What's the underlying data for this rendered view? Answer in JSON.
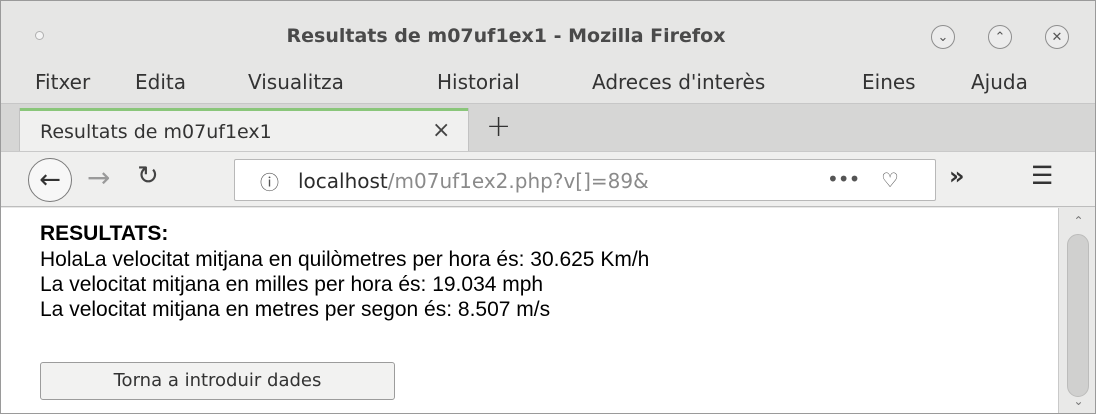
{
  "window": {
    "title": "Resultats de m07uf1ex1 - Mozilla Firefox",
    "controls": [
      "minimize-icon",
      "maximize-icon",
      "close-icon"
    ]
  },
  "menubar": {
    "items": [
      {
        "label": "Fitxer"
      },
      {
        "label": "Edita"
      },
      {
        "label": "Visualitza"
      },
      {
        "label": "Historial"
      },
      {
        "label": "Adreces d'interès"
      },
      {
        "label": "Eines"
      },
      {
        "label": "Ajuda"
      }
    ]
  },
  "tabs": {
    "active_title": "Resultats de m07uf1ex1",
    "close_glyph": "×",
    "new_tab_glyph": "+"
  },
  "navbar": {
    "url_host": "localhost",
    "url_path": "/m07uf1ex2.php?v[]=89&",
    "more_glyph": "•••",
    "icons": [
      "back-arrow-icon",
      "forward-arrow-icon",
      "reload-icon",
      "info-icon",
      "pocket-icon",
      "overflow-icon",
      "hamburger-menu-icon"
    ]
  },
  "content": {
    "heading": "RESULTATS:",
    "line1": "HolaLa velocitat mitjana en quilòmetres per hora és: 30.625 Km/h",
    "line2": "La velocitat mitjana en milles per hora és: 19.034 mph",
    "line3": "La velocitat mitjana en metres per segon és: 8.507 m/s",
    "button_label": "Torna a introduir dades"
  },
  "colors": {
    "tab_accent": "#8ac67a",
    "page_background": "#ffffff",
    "chrome_background": "#e6e6e5"
  }
}
